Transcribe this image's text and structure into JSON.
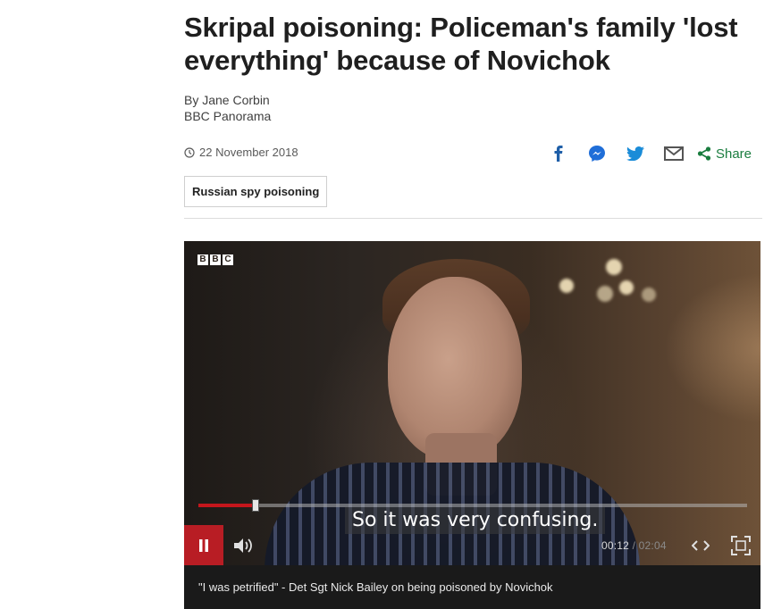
{
  "article": {
    "headline": "Skripal poisoning: Policeman's family 'lost everything' because of Novichok",
    "author": "By Jane Corbin",
    "outlet": "BBC Panorama",
    "date": "22 November 2018",
    "share_label": "Share",
    "tag": "Russian spy poisoning"
  },
  "colors": {
    "share_green": "#1a7d3f",
    "social_blue": "#1f5fa8",
    "progress_red": "#c4161c"
  },
  "share_icons": [
    "facebook-icon",
    "messenger-icon",
    "twitter-icon",
    "email-icon",
    "share-icon"
  ],
  "video": {
    "logo_letters": [
      "B",
      "B",
      "C"
    ],
    "subtitle": "So it was very confusing.",
    "current_time": "00:12",
    "separator": "/",
    "duration": "02:04",
    "progress": 0.104,
    "caption": "\"I was petrified\" - Det Sgt Nick Bailey on being poisoned by Novichok"
  }
}
